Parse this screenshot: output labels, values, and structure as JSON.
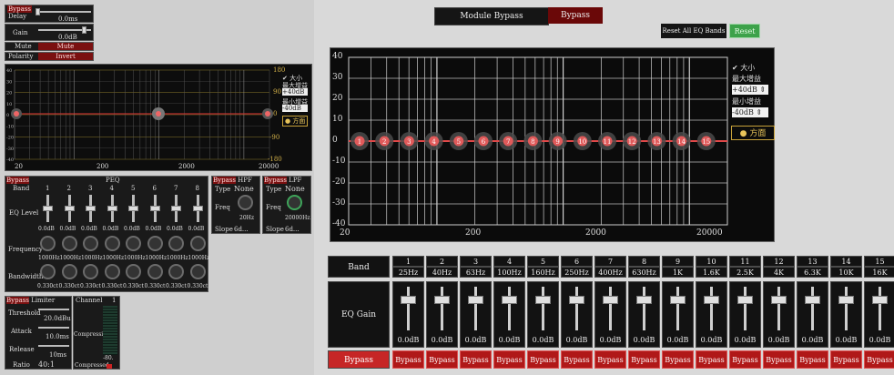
{
  "left": {
    "top_controls": {
      "bypass_label": "Bypass",
      "delay_label": "Delay",
      "delay_value": "0.0ms",
      "gain_label": "Gain",
      "gain_value": "0.0dB",
      "mute_label": "Mute",
      "mute_button": "Mute",
      "polarity_label": "Polarity",
      "polarity_button": "Invert"
    },
    "mini_graph": {
      "y_ticks_left": [
        "40",
        "30",
        "20",
        "10",
        "0",
        "-10",
        "-20",
        "-30",
        "-40"
      ],
      "y_ticks_right": [
        "180",
        "90",
        "0",
        "-90",
        "-180"
      ],
      "x_ticks": [
        "20",
        "200",
        "2000",
        "20000"
      ],
      "side_checkbox": "大小",
      "max_gain_label": "最大增益",
      "max_gain_value": "+40dB",
      "min_gain_label": "最小增益",
      "min_gain_value": "-40dB",
      "direction": "方面"
    },
    "peq": {
      "bypass": "Bypass",
      "title": "PEQ",
      "band_label": "Band",
      "bands": [
        "1",
        "2",
        "3",
        "4",
        "5",
        "6",
        "7",
        "8"
      ],
      "eq_level_label": "EQ Level",
      "eq_values": [
        "0.0dB",
        "0.0dB",
        "0.0dB",
        "0.0dB",
        "0.0dB",
        "0.0dB",
        "0.0dB",
        "0.0dB"
      ],
      "frequency_label": "Frequency",
      "freq_values": [
        "1000Hz",
        "1000Hz",
        "1000Hz",
        "1000Hz",
        "1000Hz",
        "1000Hz",
        "1000Hz",
        "1000Hz"
      ],
      "bandwidth_label": "Bandwidth",
      "bw_values": [
        "0.330ct",
        "0.330ct",
        "0.330ct",
        "0.330ct",
        "0.330ct",
        "0.330ct",
        "0.330ct",
        "0.330ct"
      ]
    },
    "hpf": {
      "bypass": "Bypass",
      "title": "HPF",
      "type_label": "Type",
      "type_value": "None",
      "freq_label": "Freq",
      "freq_value": "20Hz",
      "slope_label": "Slope",
      "slope_value": "6d..."
    },
    "lpf": {
      "bypass": "Bypass",
      "title": "LPF",
      "type_label": "Type",
      "type_value": "None",
      "freq_label": "Freq",
      "freq_value": "20000Hz",
      "slope_label": "Slope",
      "slope_value": "6d..."
    },
    "limiter": {
      "bypass": "Bypass",
      "title": "Limiter",
      "threshold_label": "Threshold",
      "threshold_value": "20.0dBu",
      "attack_label": "Attack",
      "attack_value": "10.0ms",
      "release_label": "Release",
      "release_value": "10ms",
      "ratio_label": "Ratio",
      "ratio_value": "40:1"
    },
    "channel": {
      "title": "Channel",
      "number": "1",
      "compression_label": "Compression",
      "meter_value": "-80.",
      "compressed_label": "Compressed"
    }
  },
  "right": {
    "module_bypass_label": "Module Bypass",
    "bypass_button": "Bypass",
    "reset_label": "Reset All EQ Bands",
    "reset_button": "Reset",
    "graph": {
      "y_ticks": [
        "40",
        "30",
        "20",
        "10",
        "0",
        "-10",
        "-20",
        "-30",
        "-40"
      ],
      "x_ticks": [
        "20",
        "200",
        "2000",
        "20000"
      ],
      "nodes": [
        "1",
        "2",
        "3",
        "4",
        "5",
        "6",
        "7",
        "8",
        "9",
        "10",
        "11",
        "12",
        "13",
        "14",
        "15"
      ],
      "size_checkbox": "大小",
      "max_gain_label": "最大增益",
      "max_gain_value": "+40dB",
      "min_gain_label": "最小增益",
      "min_gain_value": "-40dB",
      "direction_label": "方面"
    },
    "table": {
      "band_label": "Band",
      "eq_gain_label": "EQ Gain",
      "bypass_label": "Bypass",
      "band_numbers": [
        "1",
        "2",
        "3",
        "4",
        "5",
        "6",
        "7",
        "8",
        "9",
        "10",
        "11",
        "12",
        "13",
        "14",
        "15"
      ],
      "band_freqs": [
        "25Hz",
        "40Hz",
        "63Hz",
        "100Hz",
        "160Hz",
        "250Hz",
        "400Hz",
        "630Hz",
        "1K",
        "1.6K",
        "2.5K",
        "4K",
        "6.3K",
        "10K",
        "16K"
      ],
      "gains": [
        "0.0dB",
        "0.0dB",
        "0.0dB",
        "0.0dB",
        "0.0dB",
        "0.0dB",
        "0.0dB",
        "0.0dB",
        "0.0dB",
        "0.0dB",
        "0.0dB",
        "0.0dB",
        "0.0dB",
        "0.0dB",
        "0.0dB"
      ],
      "bypass_buttons": [
        "Bypass",
        "Bypass",
        "Bypass",
        "Bypass",
        "Bypass",
        "Bypass",
        "Bypass",
        "Bypass",
        "Bypass",
        "Bypass",
        "Bypass",
        "Bypass",
        "Bypass",
        "Bypass",
        "Bypass"
      ]
    }
  }
}
